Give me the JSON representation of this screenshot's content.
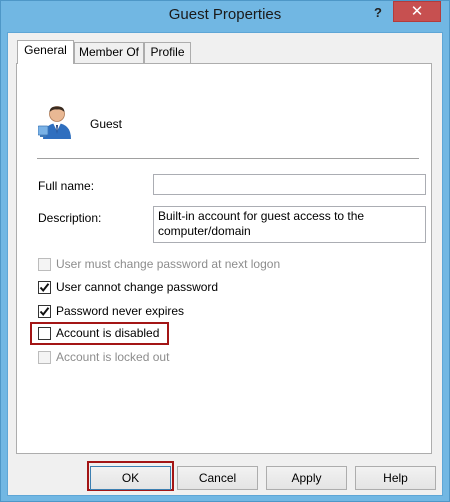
{
  "window": {
    "title": "Guest Properties",
    "help_label": "?",
    "close_label": "✕"
  },
  "tabs": [
    {
      "label": "General",
      "active": true
    },
    {
      "label": "Member Of",
      "active": false
    },
    {
      "label": "Profile",
      "active": false
    }
  ],
  "general": {
    "user_icon": "user-icon",
    "username": "Guest",
    "full_name_label": "Full name:",
    "full_name_value": "",
    "description_label": "Description:",
    "description_value": "Built-in account for guest access to the computer/domain"
  },
  "options": [
    {
      "label": "User must change password at next logon",
      "checked": false,
      "disabled": true
    },
    {
      "label": "User cannot change password",
      "checked": true,
      "disabled": false
    },
    {
      "label": "Password never expires",
      "checked": true,
      "disabled": false
    },
    {
      "label": "Account is disabled",
      "checked": false,
      "disabled": false,
      "highlighted": true
    },
    {
      "label": "Account is locked out",
      "checked": false,
      "disabled": true
    }
  ],
  "buttons": {
    "ok": "OK",
    "cancel": "Cancel",
    "apply": "Apply",
    "help": "Help"
  },
  "colors": {
    "highlight": "#a31515",
    "close_button": "#c75050",
    "window_frame": "#71b7e3"
  }
}
